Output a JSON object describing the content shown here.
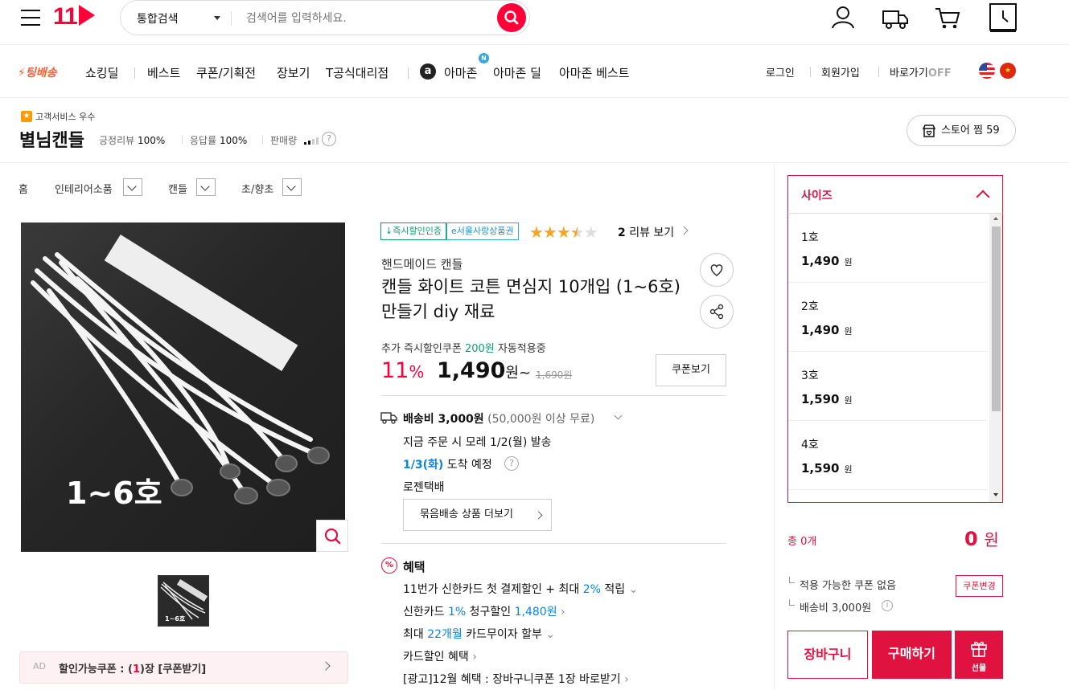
{
  "header": {
    "logo_text": "11",
    "search_scope": "통합검색",
    "search_placeholder": "검색어를 입력하세요."
  },
  "nav": {
    "ting": "⚡팅배송",
    "items": [
      "쇼킹딜",
      "베스트",
      "쿠폰/기획전",
      "장보기",
      "T공식대리점",
      "아마존",
      "아마존 딜",
      "아마존 베스트"
    ],
    "amazon_badge": "N",
    "amazon_logo": "a",
    "right": [
      "로그인",
      "회원가입",
      "바로가기",
      "OFF"
    ]
  },
  "seller": {
    "service_badge": "고객서비스 우수",
    "name": "별님캔들",
    "positive_review_label": "긍정리뷰",
    "positive_review": "100%",
    "response_label": "응답률",
    "response": "100%",
    "sales_label": "판매량",
    "store_button": "스토어 찜 59"
  },
  "breadcrumb": [
    "홈",
    "인테리어소품",
    "캔들",
    "초/향초"
  ],
  "image": {
    "overlay_text": "1~6호",
    "thumb_text": "1~6호"
  },
  "ad": {
    "label": "AD",
    "text_before": "할인가능쿠폰 : (",
    "count": "1",
    "text_after": ")장 [쿠폰받기]"
  },
  "product": {
    "tags": [
      "↓즉시할인인증",
      "e서울사랑상품권"
    ],
    "rating": 3.5,
    "review_count": "2",
    "review_label": "리뷰 보기",
    "category": "핸드메이드 캔들",
    "title": "캔들 화이트 코튼 면심지 10개입 (1~6호) 만들기 diy 재료",
    "coupon_prefix": "추가 즉시할인쿠폰",
    "coupon_amount": "200원",
    "coupon_suffix": "자동적용중",
    "discount": "11",
    "discount_unit": "%",
    "price": "1,490",
    "price_unit": "원~",
    "original_price": "1,690원",
    "coupon_button": "쿠폰보기"
  },
  "shipping": {
    "fee": "배송비 3,000원",
    "free_condition": "(50,000원 이상 무료)",
    "dispatch": "지금 주문 시 모레 1/2(월) 발송",
    "arrival_date": "1/3(화)",
    "arrival_suffix": "도착 예정",
    "courier": "로젠택배",
    "bundle_button": "묶음배송 상품 더보기"
  },
  "benefits": {
    "title": "혜택",
    "lines": [
      {
        "a": "11번가 신한카드 첫 결제할인 + 최대 ",
        "b": "2%",
        "c": " 적립"
      },
      {
        "a": "신한카드 ",
        "b": "1%",
        "c": " 청구할인 ",
        "d": "1,480원"
      },
      {
        "a": "최대 ",
        "b": "22개월",
        "c": " 카드무이자 할부"
      },
      {
        "a": "카드할인 혜택"
      },
      {
        "a": "[광고]12월 혜택 : 장바구니쿠폰 1장 바로받기"
      }
    ]
  },
  "options": {
    "header": "사이즈",
    "items": [
      {
        "name": "1호",
        "price": "1,490",
        "unit": "원"
      },
      {
        "name": "2호",
        "price": "1,490",
        "unit": "원"
      },
      {
        "name": "3호",
        "price": "1,590",
        "unit": "원"
      },
      {
        "name": "4호",
        "price": "1,590",
        "unit": "원"
      }
    ]
  },
  "summary": {
    "total_label": "총 0개",
    "total_price": "0",
    "total_unit": "원",
    "coupon_none": "적용 가능한 쿠폰 없음",
    "coupon_change": "쿠폰변경",
    "shipping": "배송비 3,000원",
    "cart": "장바구니",
    "buy": "구매하기",
    "gift": "선물"
  },
  "colors": {
    "accent": "#ff0038",
    "blue": "#0b83e6",
    "green": "#0aa06b",
    "star": "#f5a623"
  }
}
